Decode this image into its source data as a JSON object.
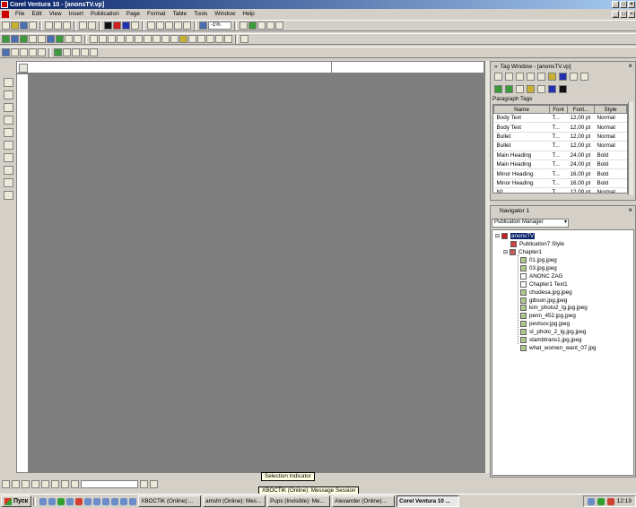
{
  "window": {
    "title": "Corel Ventura 10 - [anonsTV.vp]"
  },
  "menu": [
    "File",
    "Edit",
    "View",
    "Insert",
    "Publication",
    "Page",
    "Format",
    "Table",
    "Tools",
    "Window",
    "Help"
  ],
  "toolbar": {
    "zoom_value": "-1%"
  },
  "tag_window": {
    "title": "Tag Window - [anonsTV.vp]",
    "section": "Paragraph Tags",
    "columns": [
      "Name",
      "Font",
      "Font...",
      "Style"
    ],
    "rows": [
      {
        "name": "Body Text",
        "font": "T...",
        "size": "12,00 pt",
        "style": "Normal"
      },
      {
        "name": "Body Text",
        "font": "T...",
        "size": "12,00 pt",
        "style": "Normal"
      },
      {
        "name": "Bullet",
        "font": "T...",
        "size": "12,00 pt",
        "style": "Normal"
      },
      {
        "name": "Bullet",
        "font": "T...",
        "size": "12,00 pt",
        "style": "Normal"
      },
      {
        "name": "Main Heading",
        "font": "T...",
        "size": "24,00 pt",
        "style": "Bold"
      },
      {
        "name": "Main Heading",
        "font": "T...",
        "size": "24,00 pt",
        "style": "Bold"
      },
      {
        "name": "Minor Heading",
        "font": "T...",
        "size": "16,00 pt",
        "style": "Bold"
      },
      {
        "name": "Minor Heading",
        "font": "T...",
        "size": "16,00 pt",
        "style": "Bold"
      },
      {
        "name": "N1",
        "font": "T...",
        "size": "12,00 pt",
        "style": "Normal"
      }
    ]
  },
  "navigator": {
    "title": "Navigator 1",
    "view": "Publication Manager",
    "root": "anonsTV",
    "style": "Publication7 Style",
    "chapter": "Chapter1",
    "items": [
      "01.jpg.jpeg",
      "03.jpg.jpeg",
      "ANONC ZAG",
      "Chapter1 Text1",
      "chudesa.jpg.jpeg",
      "gibson.jpg.jpeg",
      "kim_photo2_lg.jpg.jpeg",
      "penn_452.jpg.jpeg",
      "pevtsov.jpg.jpeg",
      "st_photo_2_lg.jpg.jpeg",
      "stambtrans1.jpg.jpeg",
      "what_women_want_07.jpg"
    ]
  },
  "status": {
    "tooltip": "Selection Indicator",
    "notification": "XBOCTiK (Online): Message Session"
  },
  "taskbar": {
    "start": "Пуск",
    "tasks": [
      "XBOCTiK (Online):...",
      "amsht (Online): Mes...",
      "Pups (Invisible): Me...",
      "Alexander (Online)...",
      "Corel Ventura 10 ..."
    ],
    "clock": "12:19"
  }
}
